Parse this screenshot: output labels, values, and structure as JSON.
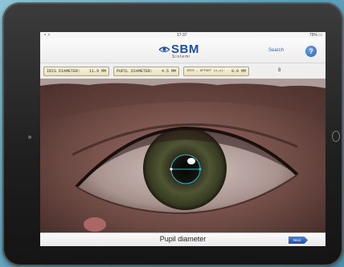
{
  "status_bar": {
    "time": "17:37",
    "battery": "75%"
  },
  "header": {
    "logo_text": "SBM",
    "logo_subtitle": "Sistemi",
    "search_label": "Search",
    "help_label": "?"
  },
  "readouts": {
    "iris": {
      "label": "IRIS DIAMETER:",
      "value": "11.9 MM"
    },
    "pupil": {
      "label": "PUPIL DIAMETER:",
      "value": "4.5 MM"
    },
    "iris_offset": {
      "label": "IRIS - OFFSET (x,y):",
      "value": "0.0 MM"
    },
    "extra_value": "8"
  },
  "footer": {
    "title": "Pupil diameter",
    "next_label": "Next"
  },
  "colors": {
    "brand_blue": "#1f4fa0",
    "measure_line": "#2fb6c9",
    "readout_bg": "#efe8c6"
  }
}
